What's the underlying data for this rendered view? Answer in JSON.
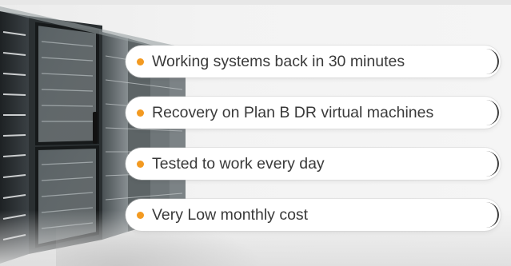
{
  "features": [
    {
      "label": "Working systems back in 30 minutes"
    },
    {
      "label": "Recovery on Plan B DR virtual machines"
    },
    {
      "label": "Tested to work every day"
    },
    {
      "label": "Very Low monthly cost"
    }
  ],
  "colors": {
    "bullet": "#f39a21",
    "text": "#3a3a3a",
    "pill": "#ffffff"
  },
  "icons": {
    "background": "server-racks-illustration",
    "bullet": "orange-dot-icon"
  }
}
